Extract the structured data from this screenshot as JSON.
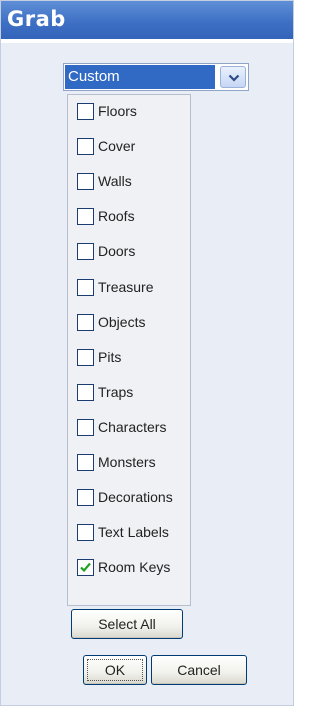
{
  "panel": {
    "title": "Grab"
  },
  "filter": {
    "selected": "Custom",
    "arrow_icon": "chevron-down-icon"
  },
  "items": [
    {
      "label": "Floors",
      "checked": false
    },
    {
      "label": "Cover",
      "checked": false
    },
    {
      "label": "Walls",
      "checked": false
    },
    {
      "label": "Roofs",
      "checked": false
    },
    {
      "label": "Doors",
      "checked": false
    },
    {
      "label": "Treasure",
      "checked": false
    },
    {
      "label": "Objects",
      "checked": false
    },
    {
      "label": "Pits",
      "checked": false
    },
    {
      "label": "Traps",
      "checked": false
    },
    {
      "label": "Characters",
      "checked": false
    },
    {
      "label": "Monsters",
      "checked": false
    },
    {
      "label": "Decorations",
      "checked": false
    },
    {
      "label": "Text Labels",
      "checked": false
    },
    {
      "label": "Room Keys",
      "checked": true
    }
  ],
  "buttons": {
    "select_all": "Select All",
    "ok": "OK",
    "cancel": "Cancel"
  },
  "colors": {
    "title_bar": "#3d6fc4",
    "selection": "#316ac5",
    "check_mark": "#21a121"
  }
}
